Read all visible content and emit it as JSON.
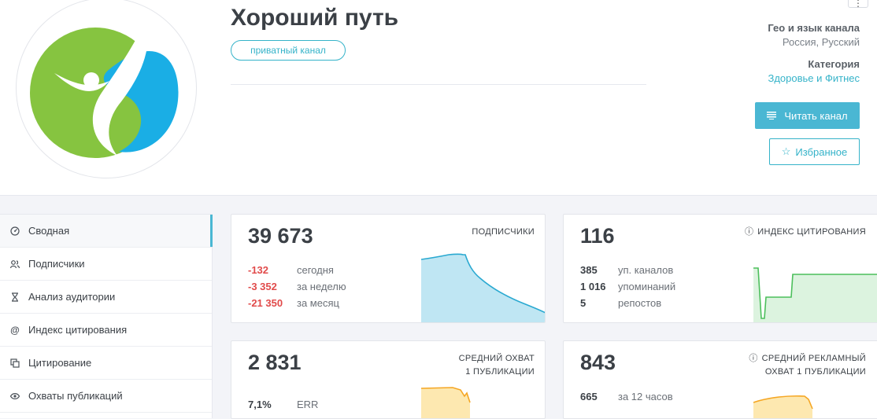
{
  "channel": {
    "title": "Хороший путь",
    "badge": "приватный канал"
  },
  "meta": {
    "geo_label": "Гео и язык канала",
    "geo_value": "Россия, Русский",
    "category_label": "Категория",
    "category_value": "Здоровье и Фитнес"
  },
  "actions": {
    "read_label": "Читать канал",
    "favorite_label": "Избранное"
  },
  "sidebar": {
    "items": [
      {
        "label": "Сводная",
        "icon": "dashboard-icon"
      },
      {
        "label": "Подписчики",
        "icon": "users-icon"
      },
      {
        "label": "Анализ аудитории",
        "icon": "hourglass-icon"
      },
      {
        "label": "Индекс цитирования",
        "icon": "at-icon"
      },
      {
        "label": "Цитирование",
        "icon": "quote-icon"
      },
      {
        "label": "Охваты публикаций",
        "icon": "eye-icon"
      }
    ]
  },
  "cards": {
    "subscribers": {
      "value": "39 673",
      "caption": "ПОДПИСЧИКИ",
      "rows": [
        {
          "num": "-132",
          "label": "сегодня"
        },
        {
          "num": "-3 352",
          "label": "за неделю"
        },
        {
          "num": "-21 350",
          "label": "за месяц"
        }
      ]
    },
    "citation": {
      "value": "116",
      "caption": "ИНДЕКС ЦИТИРОВАНИЯ",
      "rows": [
        {
          "num": "385",
          "label": "уп. каналов"
        },
        {
          "num": "1 016",
          "label": "упоминаний"
        },
        {
          "num": "5",
          "label": "репостов"
        }
      ]
    },
    "reach": {
      "value": "2 831",
      "caption_line1": "СРЕДНИЙ ОХВАТ",
      "caption_line2": "1 ПУБЛИКАЦИИ",
      "rows": [
        {
          "num": "7,1%",
          "label": "ERR"
        }
      ]
    },
    "ad_reach": {
      "value": "843",
      "caption_line1": "СРЕДНИЙ РЕКЛАМНЫЙ",
      "caption_line2": "ОХВАТ 1 ПУБЛИКАЦИИ",
      "rows": [
        {
          "num": "665",
          "label": "за 12 часов"
        }
      ]
    }
  },
  "colors": {
    "accent": "#4ab7d3",
    "negative": "#e14b4b",
    "green": "#4cbf5c",
    "orange": "#f5a623"
  }
}
